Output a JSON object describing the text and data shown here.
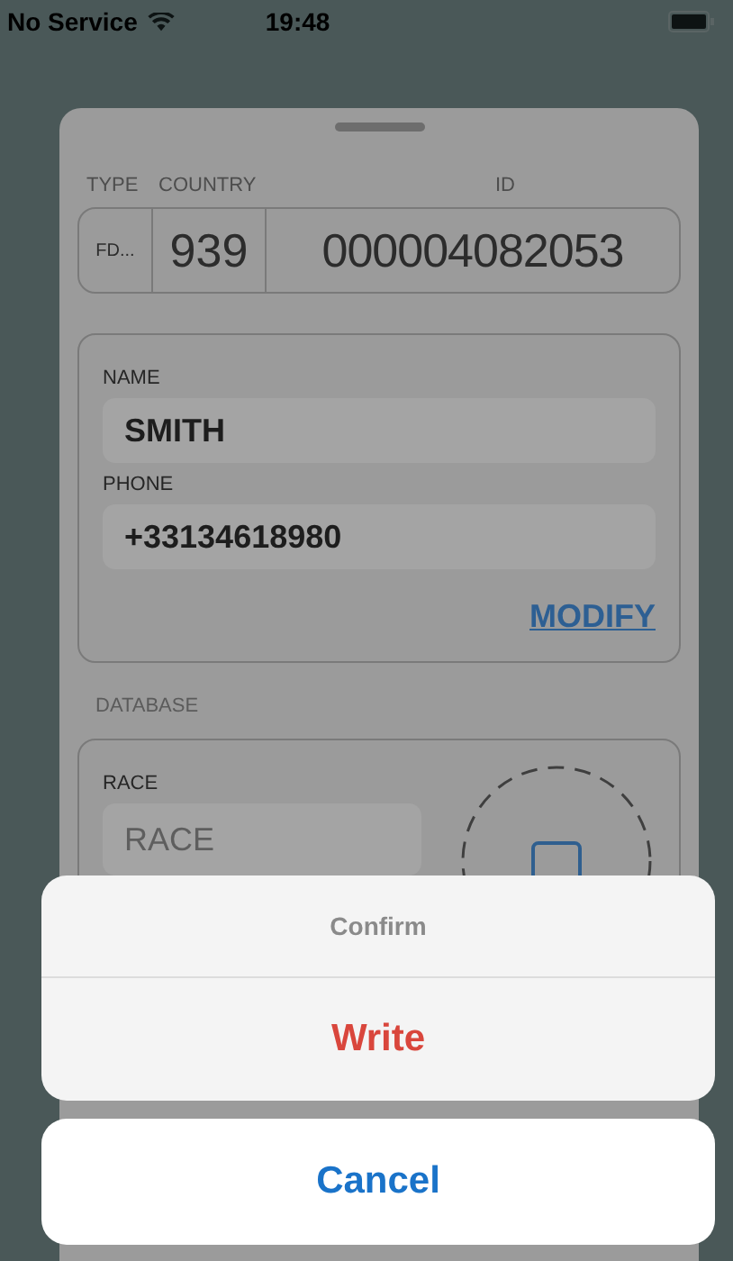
{
  "status_bar": {
    "carrier": "No Service",
    "time": "19:48"
  },
  "id_row": {
    "columns": [
      {
        "label": "TYPE",
        "value": "FD..."
      },
      {
        "label": "COUNTRY",
        "value": "939"
      },
      {
        "label": "ID",
        "value": "000004082053"
      }
    ]
  },
  "contact": {
    "fields": [
      {
        "label": "NAME",
        "value": "SMITH"
      },
      {
        "label": "PHONE",
        "value": "+33134618980"
      }
    ],
    "modify_link": "MODIFY"
  },
  "database": {
    "section_label": "DATABASE",
    "race_label": "RACE",
    "race_placeholder": "RACE"
  },
  "action_sheet": {
    "title": "Confirm",
    "actions": [
      {
        "label": "Write",
        "kind": "destructive"
      }
    ],
    "cancel": "Cancel"
  }
}
